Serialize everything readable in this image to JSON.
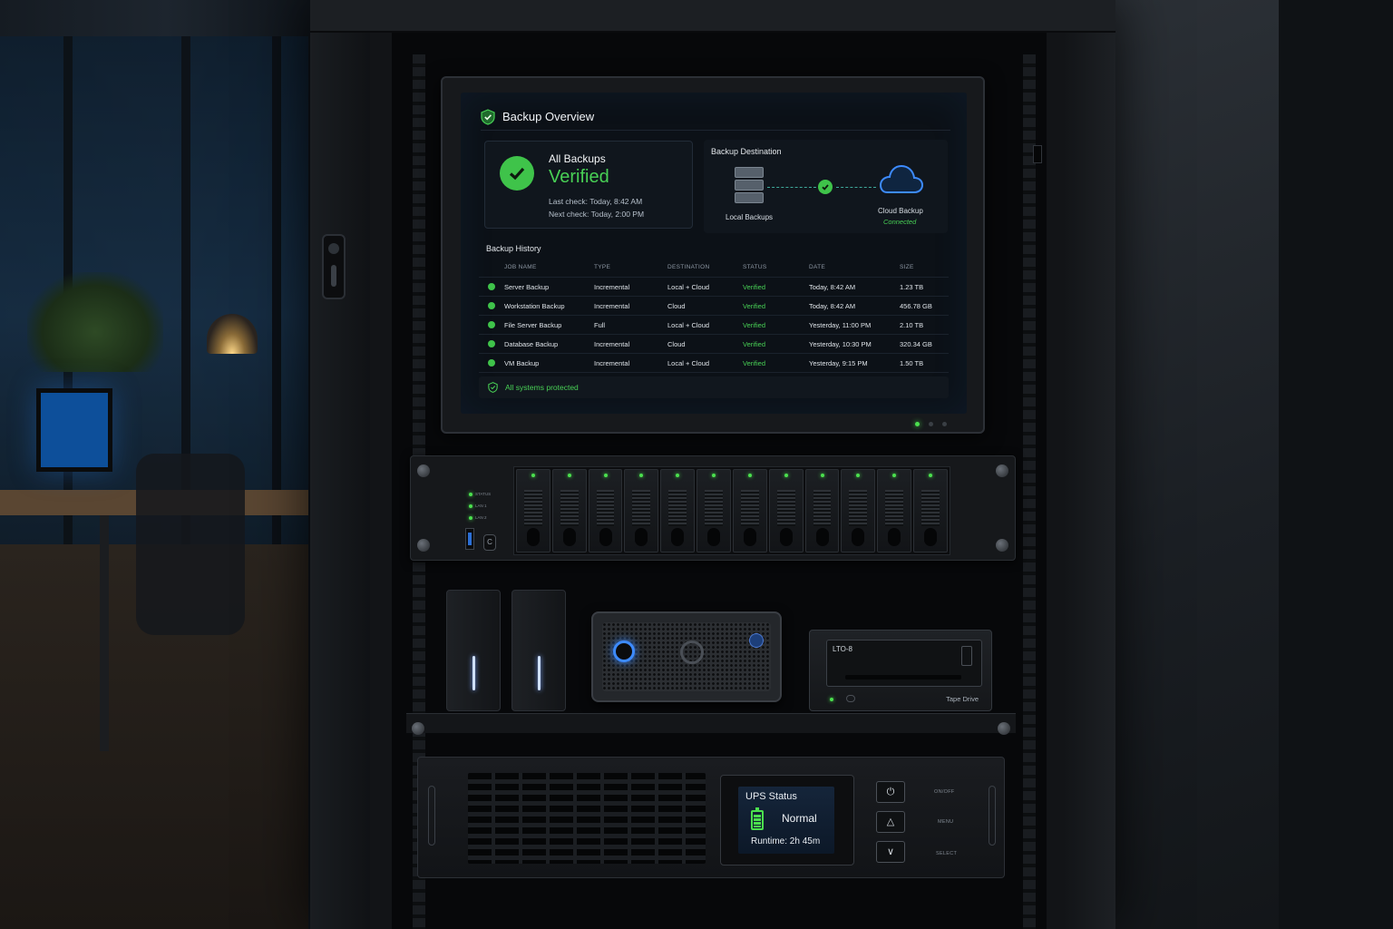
{
  "dashboard": {
    "title": "Backup Overview",
    "status_card": {
      "heading": "All Backups",
      "state": "Verified",
      "last_check": "Last check: Today, 8:42 AM",
      "next_check": "Next check: Today, 2:00 PM"
    },
    "destination": {
      "heading": "Backup Destination",
      "local_label": "Local Backups",
      "cloud_label": "Cloud Backup",
      "cloud_status": "Connected"
    },
    "history": {
      "heading": "Backup History",
      "columns": [
        "JOB NAME",
        "TYPE",
        "DESTINATION",
        "STATUS",
        "DATE",
        "SIZE"
      ],
      "rows": [
        {
          "job": "Server Backup",
          "type": "Incremental",
          "destination": "Local + Cloud",
          "status": "Verified",
          "date": "Today, 8:42 AM",
          "size": "1.23 TB"
        },
        {
          "job": "Workstation Backup",
          "type": "Incremental",
          "destination": "Cloud",
          "status": "Verified",
          "date": "Today, 8:42 AM",
          "size": "456.78 GB"
        },
        {
          "job": "File Server Backup",
          "type": "Full",
          "destination": "Local + Cloud",
          "status": "Verified",
          "date": "Yesterday, 11:00 PM",
          "size": "2.10 TB"
        },
        {
          "job": "Database Backup",
          "type": "Incremental",
          "destination": "Cloud",
          "status": "Verified",
          "date": "Yesterday, 10:30 PM",
          "size": "320.34 GB"
        },
        {
          "job": "VM Backup",
          "type": "Incremental",
          "destination": "Local + Cloud",
          "status": "Verified",
          "date": "Yesterday, 9:15 PM",
          "size": "1.50 TB"
        }
      ]
    },
    "footer": "All systems protected"
  },
  "nas": {
    "labels": [
      "STATUS",
      "LAN 1",
      "LAN 2"
    ],
    "bay_count": 12
  },
  "tape_drive": {
    "model": "LTO-8",
    "name": "Tape Drive"
  },
  "ups": {
    "title": "UPS Status",
    "state": "Normal",
    "runtime": "Runtime: 2h 45m",
    "buttons": {
      "power_label": "ON/OFF",
      "menu_label": "MENU",
      "select_label": "SELECT"
    }
  },
  "colors": {
    "accent_green": "#48d055",
    "screen_bg": "#0c1117",
    "drive_ring_blue": "#3d8bff",
    "ups_lcd_blue": "#15253a"
  },
  "icons": {
    "header": "shield-check-icon",
    "status": "check-circle-icon",
    "local": "server-stack-icon",
    "cloud": "cloud-icon",
    "footer": "shield-check-icon",
    "ups_battery": "battery-icon",
    "ups_power": "power-icon",
    "ups_up": "chevron-up-icon",
    "ups_down": "chevron-down-icon"
  }
}
